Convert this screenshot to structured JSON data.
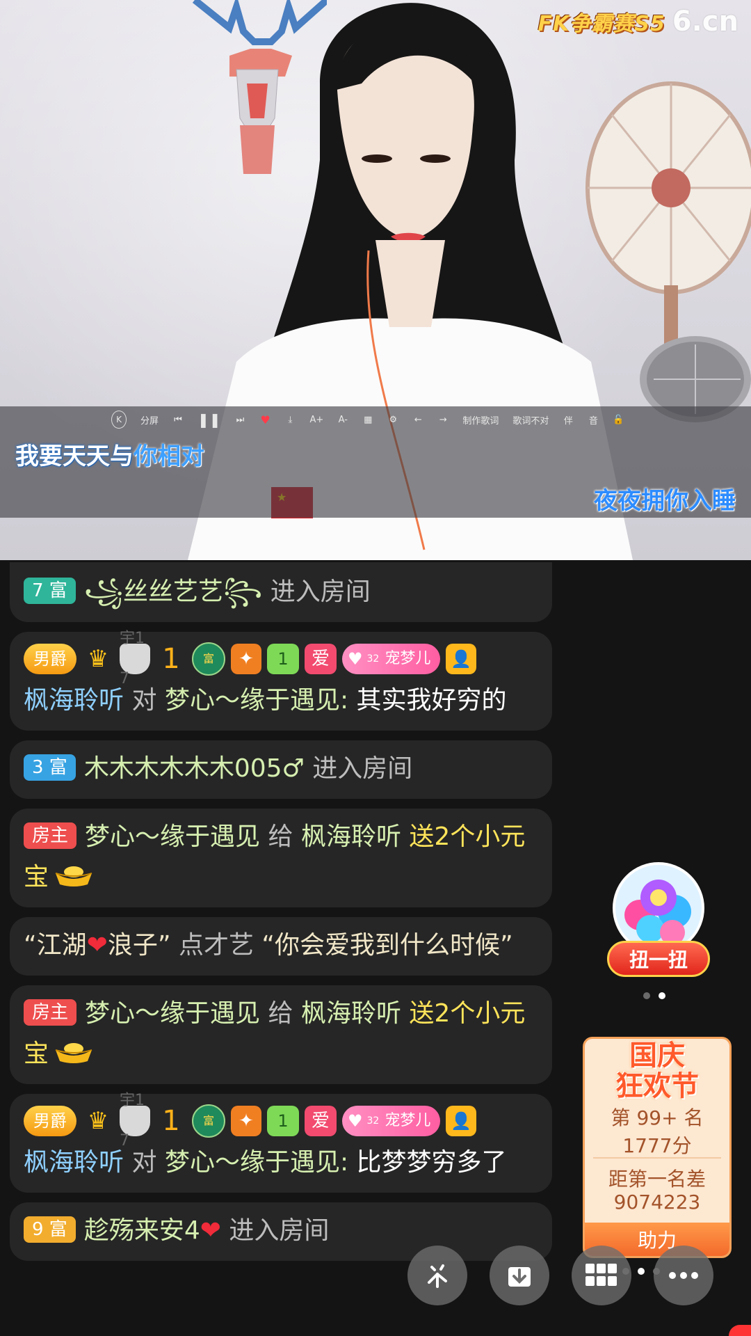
{
  "video": {
    "brand_game": "FK争霸赛S5",
    "brand_logo": "6.cn",
    "player_bar": {
      "k": "K",
      "split": "分屏",
      "prev": "⏮",
      "pause": "❚❚",
      "next": "⏭",
      "heart": "♥",
      "download": "⤓",
      "font_up": "A+",
      "font_down": "A-",
      "grid": "▦",
      "settings": "⚙",
      "left": "←",
      "right": "→",
      "make_lyrics": "制作歌词",
      "wrong_lyrics": "歌词不对",
      "voice_a": "伴",
      "voice_b": "音",
      "lock": "🔓"
    },
    "lyric_line1_a": "我要天天与",
    "lyric_line1_b": "你相对",
    "lyric_line2": "夜夜拥你入睡"
  },
  "chat": {
    "m1": {
      "level": "7 富",
      "name": "꧁丝丝艺艺꧂",
      "action": "进入房间"
    },
    "m2": {
      "badges": {
        "duke": "男爵",
        "crown": "♛",
        "shield": "宇17",
        "star": "1",
        "medal": "富",
        "gift": "✦",
        "lv": "1",
        "ai": "爱",
        "fan_num": "32",
        "fan": "宠梦儿",
        "user": "👤"
      },
      "from": "枫海聆听",
      "verb": "对",
      "to": "梦心～缘于遇见:",
      "text": "其实我好穷的"
    },
    "m3": {
      "level": "3 富",
      "name": "木木木木木木005♂",
      "action": "进入房间"
    },
    "m4": {
      "tag": "房主",
      "from": "梦心～缘于遇见",
      "verb": "给",
      "to": "枫海聆听",
      "gift": "送2个小元宝"
    },
    "m5": {
      "q1": "“江湖",
      "heart": "❤",
      "q2": "浪子”",
      "verb": "点才艺",
      "song": "“你会爱我到什么时候”"
    },
    "m6": {
      "tag": "房主",
      "from": "梦心～缘于遇见",
      "verb": "给",
      "to": "枫海聆听",
      "gift": "送2个小元宝"
    },
    "m7": {
      "badges": {
        "duke": "男爵",
        "crown": "♛",
        "shield": "宇17",
        "star": "1",
        "medal": "富",
        "gift": "✦",
        "lv": "1",
        "ai": "爱",
        "fan_num": "32",
        "fan": "宠梦儿",
        "user": "👤"
      },
      "from": "枫海聆听",
      "verb": "对",
      "to": "梦心～缘于遇见:",
      "text": "比梦梦穷多了"
    },
    "m8": {
      "level": "9 富",
      "name": "趁殇来安4",
      "heart": "❤",
      "action": "进入房间"
    }
  },
  "widgets": {
    "capsule_button": "扭一扭",
    "rank_title_1": "国庆",
    "rank_title_2": "狂欢节",
    "rank_position": "第 99+ 名",
    "rank_score": "1777分",
    "rank_gap_label": "距第一名差",
    "rank_gap_value": "9074223",
    "rank_button": "助力"
  },
  "colors": {
    "chat_bg": "#262626",
    "name_blue": "#8fd0ff",
    "name_green": "#d6efb0",
    "gift_yellow": "#ffe45a",
    "host_red": "#ee4e4e"
  }
}
